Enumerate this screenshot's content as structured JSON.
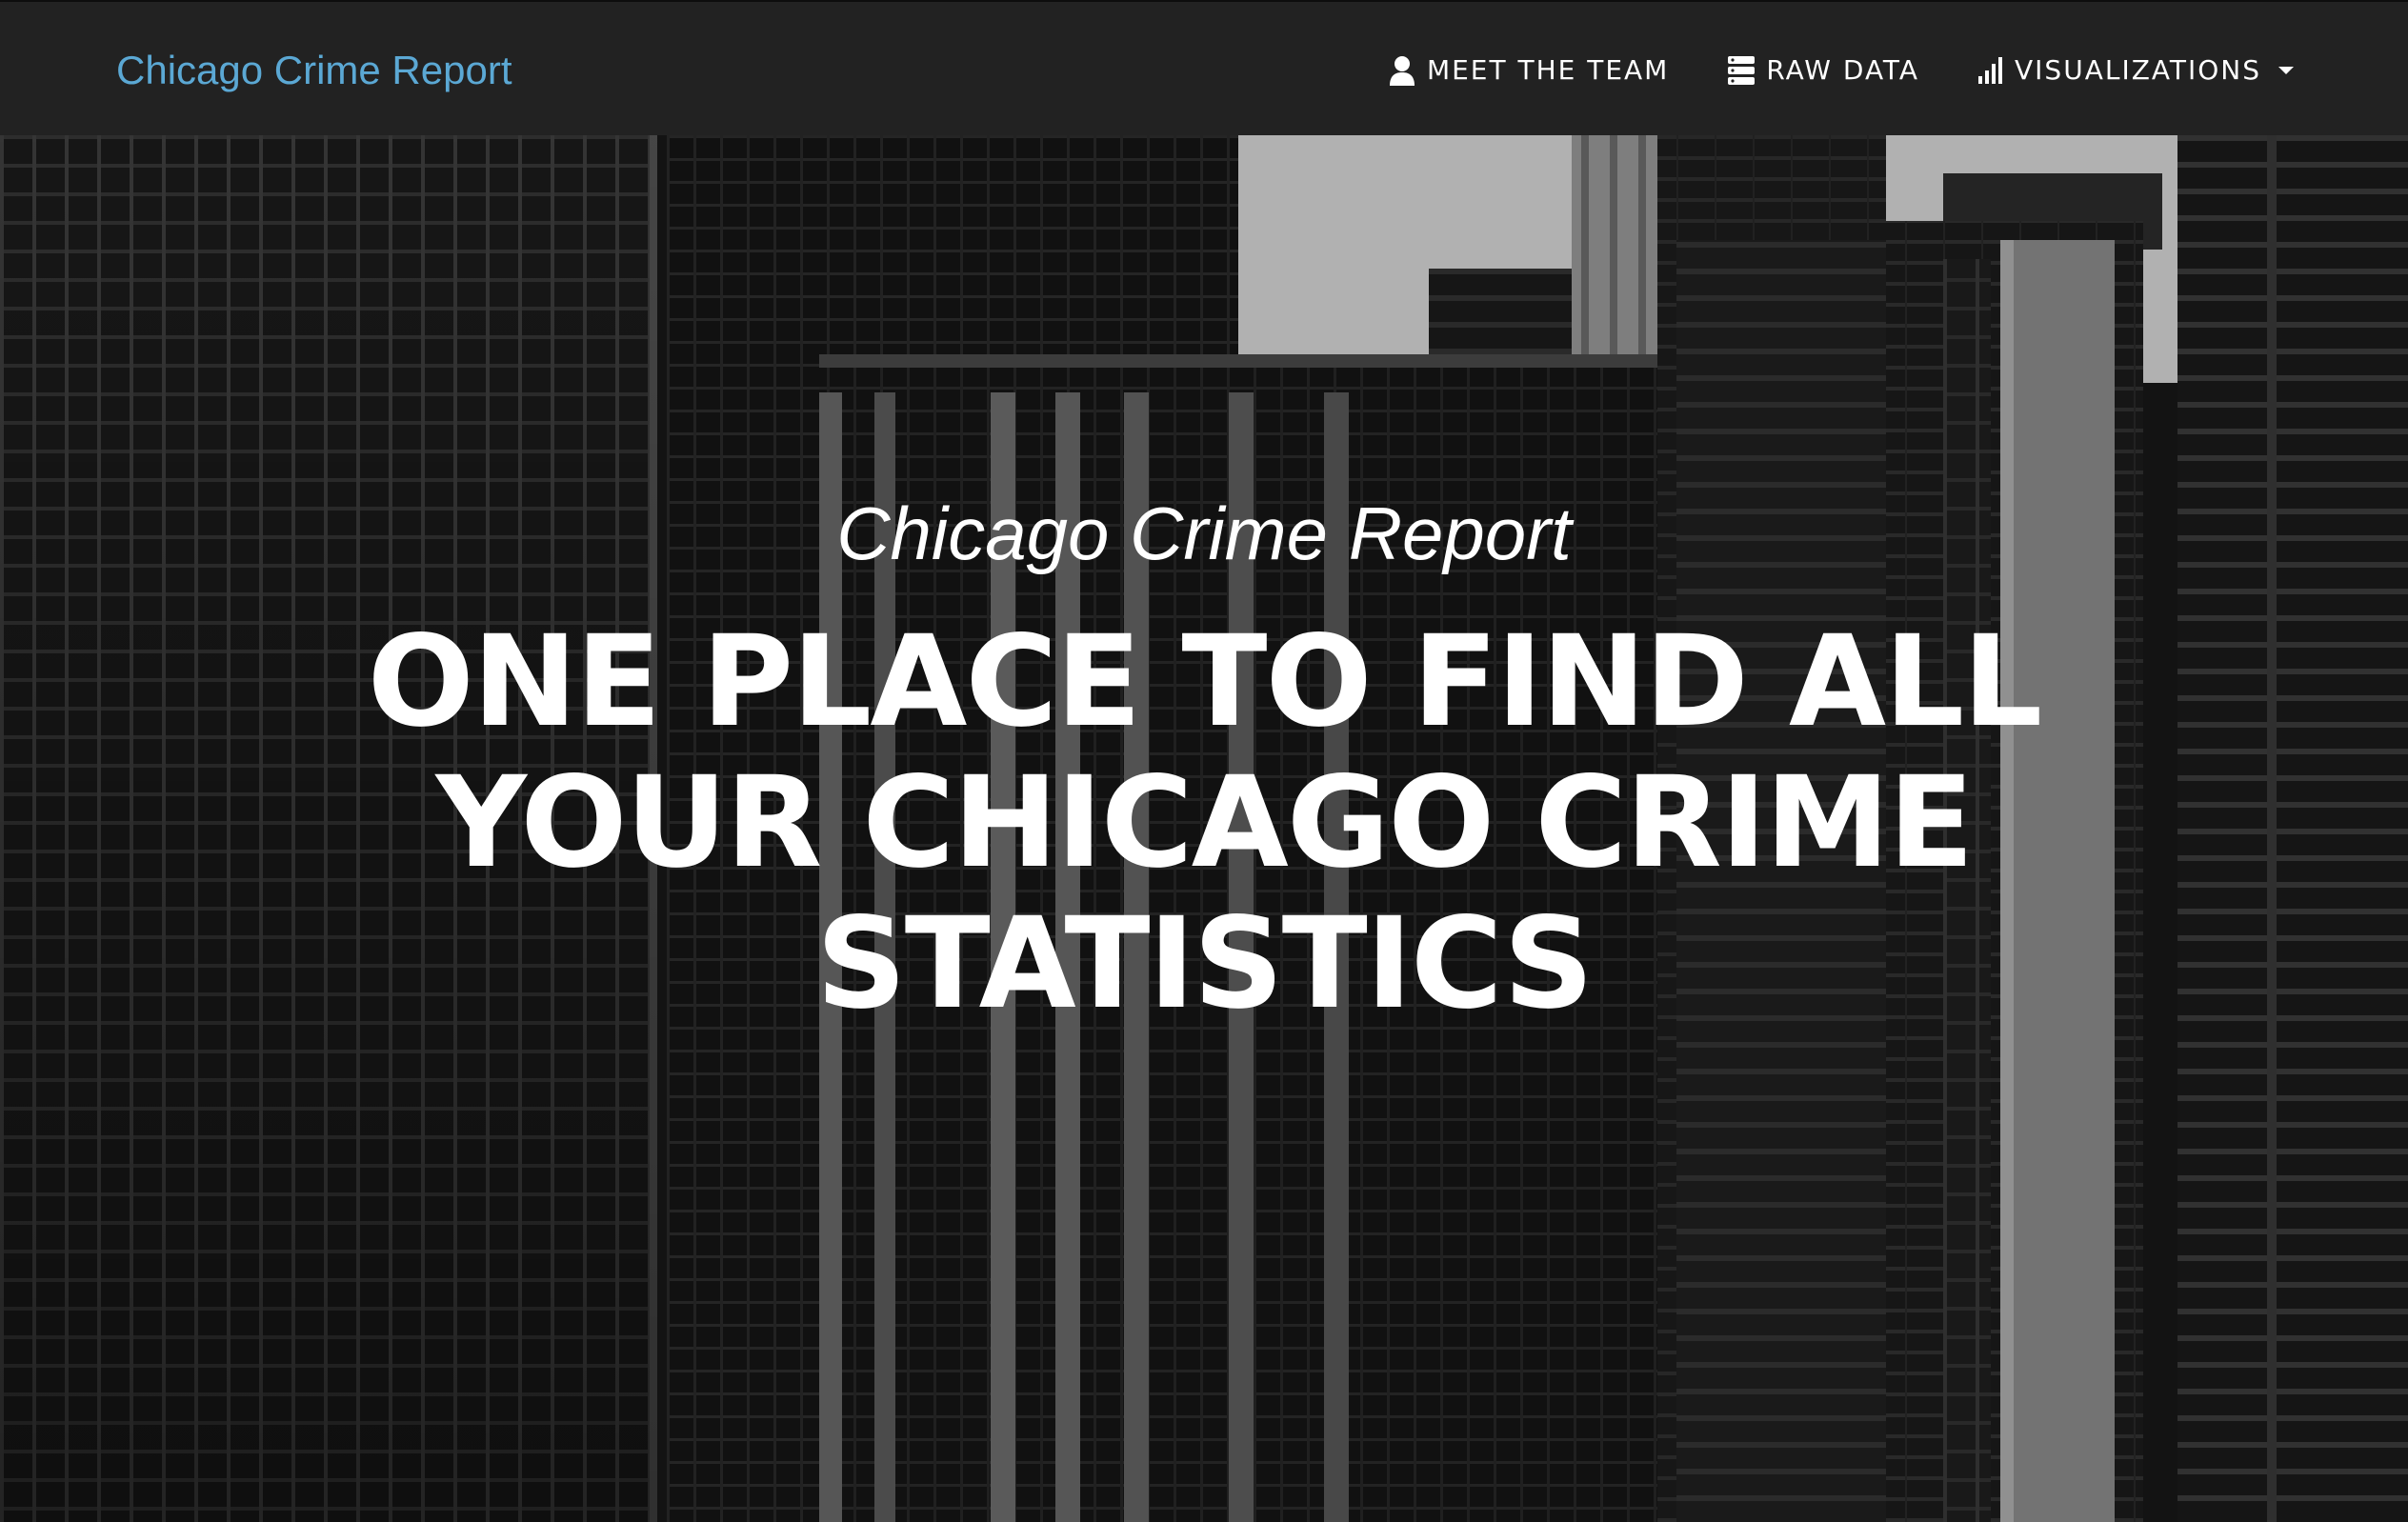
{
  "navbar": {
    "brand": "Chicago Crime Report",
    "brand_color": "#5ba8d4",
    "links": [
      {
        "label": "MEET THE TEAM",
        "icon": "user-icon"
      },
      {
        "label": "RAW DATA",
        "icon": "database-icon"
      },
      {
        "label": "VISUALIZATIONS",
        "icon": "bar-chart-icon",
        "dropdown": true
      }
    ]
  },
  "hero": {
    "subtitle": "Chicago Crime Report",
    "headline": "ONE PLACE TO FIND ALL YOUR CHICAGO CRIME STATISTICS",
    "background": "black-and-white-skyscrapers-photo"
  }
}
